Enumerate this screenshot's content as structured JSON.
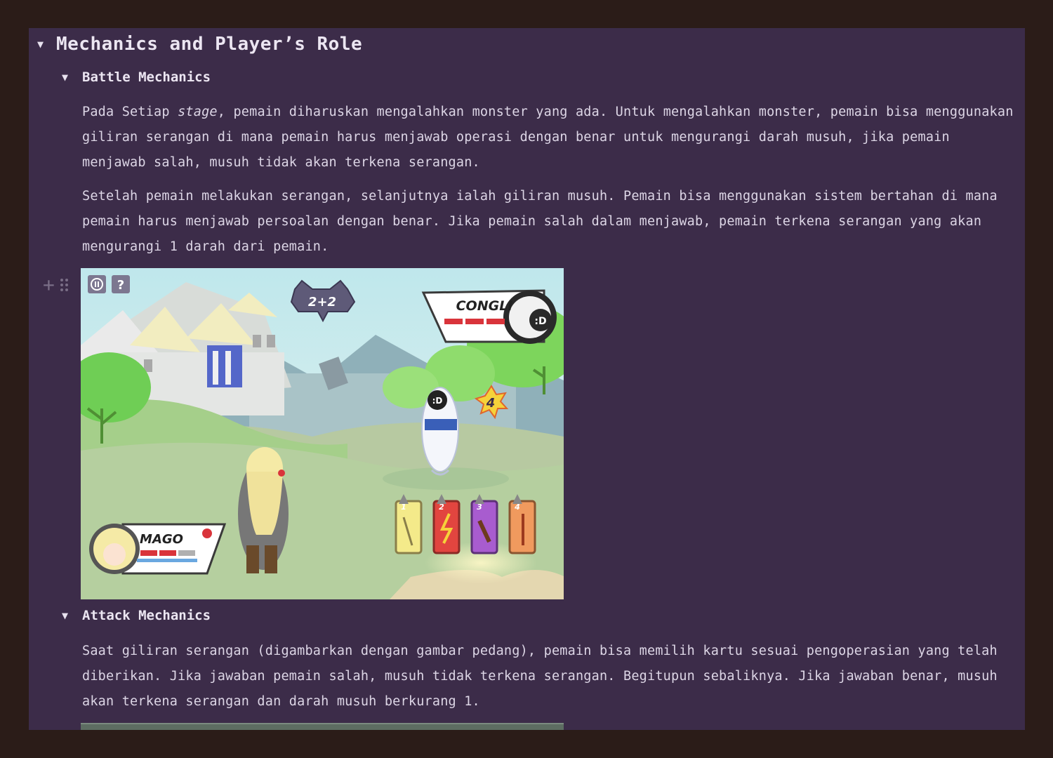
{
  "page": {
    "section_title": "Mechanics and Player’s Role",
    "battle": {
      "heading": "Battle Mechanics",
      "p1_a": "Pada Setiap ",
      "p1_em": "stage",
      "p1_b": ", pemain diharuskan mengalahkan monster yang ada. Untuk mengalahkan monster, pemain bisa menggunakan giliran serangan di mana pemain harus menjawab operasi dengan benar untuk mengurangi darah musuh, jika pemain menjawab salah, musuh tidak akan terkena serangan.",
      "p2": "Setelah pemain melakukan serangan, selanjutnya ialah giliran musuh. Pemain bisa menggunakan sistem bertahan di mana pemain harus menjawab persoalan dengan benar. Jika pemain salah dalam menjawab, pemain terkena serangan yang akan mengurangi 1 darah dari pemain."
    },
    "attack": {
      "heading": "Attack Mechanics",
      "p1": "Saat giliran serangan (digambarkan dengan gambar pedang), pemain bisa memilih kartu sesuai pengoperasian yang telah diberikan. Jika jawaban pemain salah, musuh tidak terkena serangan. Begitupun sebaliknya. Jika jawaban benar, musuh akan terkena serangan dan darah musuh berkurang 1."
    }
  },
  "game": {
    "question": "2+2",
    "enemy_name": "CONGLI",
    "enemy_badge": ":D",
    "player_name": "MAGO",
    "damage_number": "4",
    "cards": [
      "1",
      "2",
      "3",
      "4"
    ],
    "pause_icon": "pause-icon",
    "help_label": "?"
  },
  "colors": {
    "page_bg": "#2b1c18",
    "panel_bg": "#3c2c49",
    "text": "#ddd6e6",
    "health_red": "#d9343b"
  }
}
